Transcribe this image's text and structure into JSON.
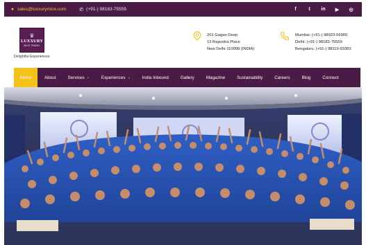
{
  "topbar": {
    "email": "sales@luxxurymice.com",
    "phone": "(+91-) 98183-75559",
    "social": [
      "facebook-icon",
      "twitter-icon",
      "linkedin-icon",
      "youtube-icon",
      "instagram-icon"
    ]
  },
  "logo": {
    "line1": "LUXXURY",
    "line2": "MICE TRAVEL",
    "tagline": "Delightful Experiences"
  },
  "address": {
    "line1": "201 Gagan Deep",
    "line2": "12 Rajendra Place",
    "line3": "New Delhi-110008 (INDIA)"
  },
  "phones": {
    "line1": "Mumbai: (+91-) 98923-56900",
    "line2": "Delhi: (+91-) 98183-75559",
    "line3": "Bengaluru: (+91-) 98119-93383"
  },
  "nav": {
    "items": [
      {
        "label": "Home",
        "active": true
      },
      {
        "label": "About"
      },
      {
        "label": "Services",
        "dropdown": true
      },
      {
        "label": "Experiences",
        "dropdown": true
      },
      {
        "label": "India Inbound"
      },
      {
        "label": "Gallery"
      },
      {
        "label": "Magazine"
      },
      {
        "label": "Sustainability"
      },
      {
        "label": "Careers"
      },
      {
        "label": "Blog"
      },
      {
        "label": "Connect"
      }
    ],
    "caret": "⌄"
  },
  "hero": {
    "description": "Group photo of a large corporate team in blue shirts with raised hands"
  },
  "colors": {
    "brand_purple": "#4a1b44",
    "accent_yellow": "#f3c319"
  }
}
